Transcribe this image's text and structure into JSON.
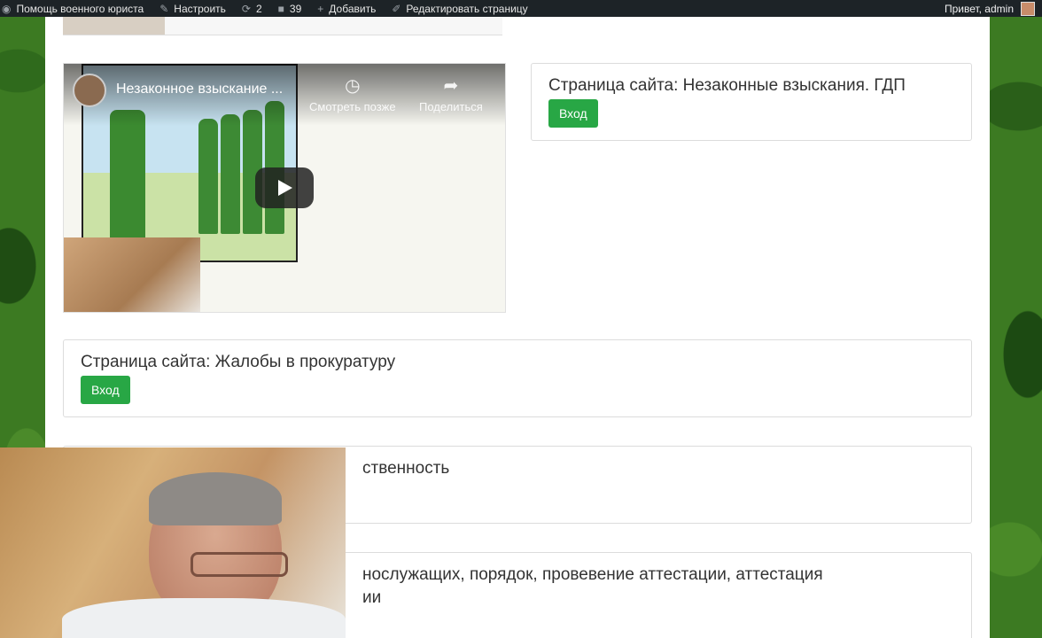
{
  "adminbar": {
    "items": [
      {
        "icon": "dashboard-icon",
        "label": "Помощь военного юриста"
      },
      {
        "icon": "brush-icon",
        "label": "Настроить"
      },
      {
        "icon": "updates-icon",
        "label": "2"
      },
      {
        "icon": "comments-icon",
        "label": "39"
      },
      {
        "icon": "plus-icon",
        "label": "Добавить"
      },
      {
        "icon": "pencil-icon",
        "label": "Редактировать страницу"
      }
    ],
    "greeting": "Привет, admin"
  },
  "video": {
    "title": "Незаконное взыскание ...",
    "watch_later": "Смотреть позже",
    "share": "Поделиться"
  },
  "cards": [
    {
      "title": "Страница сайта: Незаконные взыскания. ГДП",
      "button": "Вход"
    },
    {
      "title": "Страница сайта: Жалобы в прокуратуру",
      "button": "Вход"
    },
    {
      "title": "ственность",
      "button": ""
    },
    {
      "title": "нослужащих, порядок, провевение аттестации, аттестация",
      "title_line2": "ии",
      "button": ""
    }
  ],
  "colors": {
    "button_green": "#28a745",
    "adminbar_bg": "#1d2327"
  }
}
